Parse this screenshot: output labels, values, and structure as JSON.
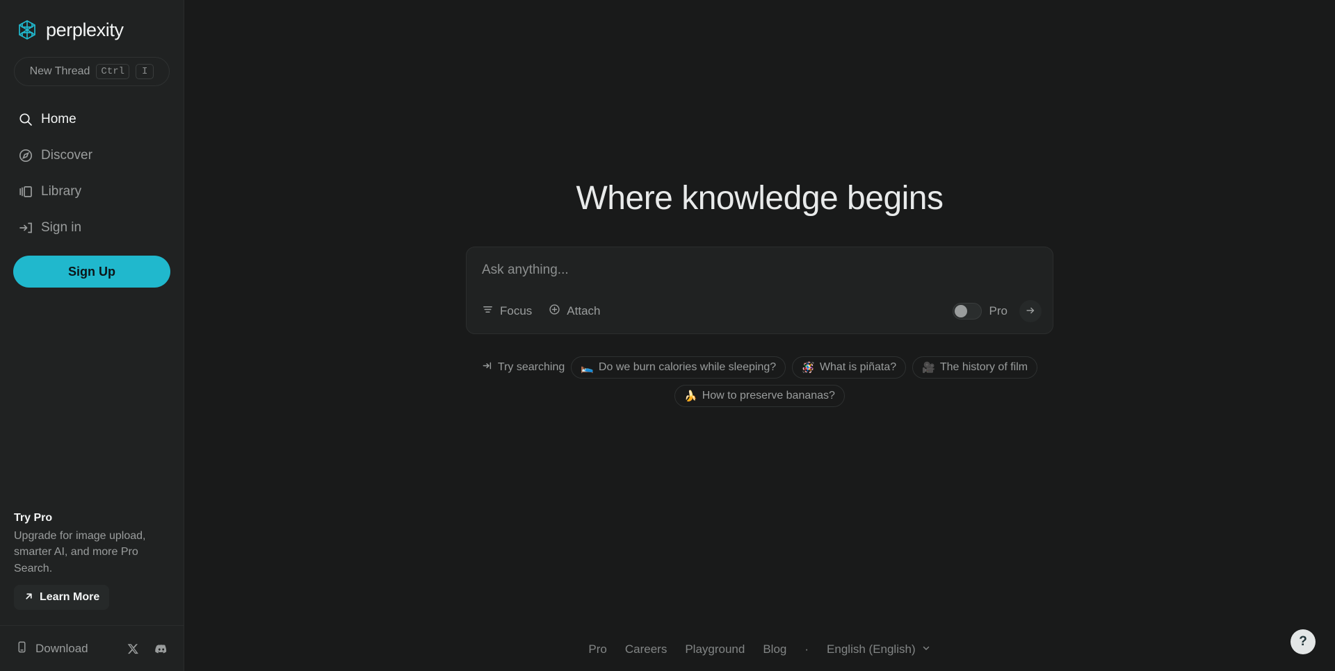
{
  "brand": {
    "name": "perplexity",
    "logo_icon": "perplexity-logo-icon",
    "accent_color": "#20b8cd"
  },
  "sidebar": {
    "new_thread": {
      "label": "New Thread",
      "key_modifier": "Ctrl",
      "key_letter": "I"
    },
    "nav_items": [
      {
        "label": "Home",
        "icon": "search-icon",
        "active": true
      },
      {
        "label": "Discover",
        "icon": "compass-icon",
        "active": false
      },
      {
        "label": "Library",
        "icon": "library-icon",
        "active": false
      },
      {
        "label": "Sign in",
        "icon": "sign-in-icon",
        "active": false
      }
    ],
    "signup_label": "Sign Up",
    "try_pro": {
      "title": "Try Pro",
      "description": "Upgrade for image upload, smarter AI, and more Pro Search.",
      "learn_more_label": "Learn More",
      "learn_more_icon": "arrow-up-right-icon"
    },
    "bottom": {
      "download_label": "Download",
      "download_icon": "mobile-device-icon",
      "socials": [
        {
          "name": "x-twitter-icon"
        },
        {
          "name": "discord-icon"
        }
      ]
    }
  },
  "main": {
    "headline": "Where knowledge begins",
    "ask": {
      "placeholder": "Ask anything...",
      "value": "",
      "focus_label": "Focus",
      "focus_icon": "filter-lines-icon",
      "attach_label": "Attach",
      "attach_icon": "plus-circle-icon",
      "pro_label": "Pro",
      "pro_enabled": false,
      "submit_icon": "arrow-right-icon"
    },
    "suggestions": {
      "prefix_label": "Try searching",
      "prefix_icon": "arrow-into-icon",
      "chips": [
        {
          "emoji": "🛌",
          "label": "Do we burn calories while sleeping?"
        },
        {
          "emoji": "🪅",
          "label": "What is piñata?"
        },
        {
          "emoji": "🎥",
          "label": "The history of film"
        },
        {
          "emoji": "🍌",
          "label": "How to preserve bananas?"
        }
      ]
    },
    "footer": {
      "links": [
        "Pro",
        "Careers",
        "Playground",
        "Blog"
      ],
      "separator": "·",
      "language": "English (English)",
      "language_icon": "chevron-down-icon"
    },
    "help_label": "?"
  }
}
